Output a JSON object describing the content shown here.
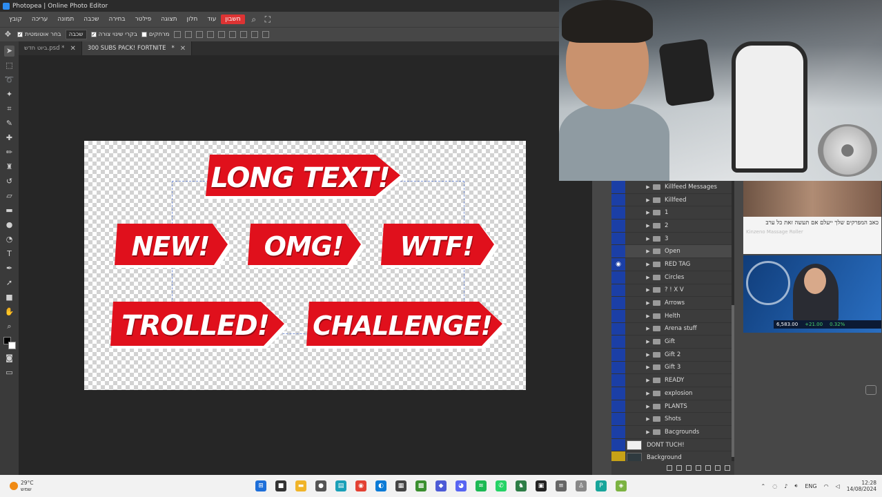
{
  "window": {
    "title": "Photopea | Online Photo Editor"
  },
  "menu": {
    "items": [
      "קובץ",
      "עריכה",
      "תמונה",
      "שכבה",
      "בחירה",
      "פילטר",
      "תצוגה",
      "חלון",
      "עוד"
    ],
    "highlight": "חשבון"
  },
  "options": {
    "auto_select_label": "בחר אוטומטית",
    "layer_select": "שכבה",
    "show_transform_label": "בקרי שינוי צורה",
    "distances_label": "מרחקים"
  },
  "tabs": [
    {
      "label": "ביוט חדש.psd *",
      "active": false
    },
    {
      "label": "300 SUBS PACK! FORTNITE",
      "active": true
    }
  ],
  "canvas": {
    "tags": [
      {
        "text": "LONG TEXT!"
      },
      {
        "text": "NEW!"
      },
      {
        "text": "OMG!"
      },
      {
        "text": "WTF!"
      },
      {
        "text": "TROLLED!"
      },
      {
        "text": "CHALLENGE!"
      }
    ],
    "tag_color": "#e0101c"
  },
  "layers": [
    {
      "name": "Killfeed Messages",
      "type": "folder"
    },
    {
      "name": "Killfeed",
      "type": "folder"
    },
    {
      "name": "1",
      "type": "folder"
    },
    {
      "name": "2",
      "type": "folder"
    },
    {
      "name": "3",
      "type": "folder"
    },
    {
      "name": "Open",
      "type": "folder"
    },
    {
      "name": "RED TAG",
      "type": "folder",
      "visible": true
    },
    {
      "name": "Circles",
      "type": "folder"
    },
    {
      "name": "? ! X V",
      "type": "folder"
    },
    {
      "name": "Arrows",
      "type": "folder"
    },
    {
      "name": "Helth",
      "type": "folder"
    },
    {
      "name": "Arena stuff",
      "type": "folder"
    },
    {
      "name": "Gift",
      "type": "folder"
    },
    {
      "name": "Gift 2",
      "type": "folder"
    },
    {
      "name": "Gift 3",
      "type": "folder"
    },
    {
      "name": "READY",
      "type": "folder"
    },
    {
      "name": "explosion",
      "type": "folder"
    },
    {
      "name": "PLANTS",
      "type": "folder"
    },
    {
      "name": "Shots",
      "type": "folder"
    },
    {
      "name": "Bacgrounds",
      "type": "folder"
    },
    {
      "name": "DONT TUCH!",
      "type": "layer"
    },
    {
      "name": "Background",
      "type": "layer"
    }
  ],
  "ads": {
    "ad1_text": "כאב המפרקים שלך ייעלם אם תעשה זאת כל ערב",
    "ad1_source": "Kinzeno Massage Roller",
    "ticker": [
      "6,583.00",
      "+21.00",
      "0.32%"
    ]
  },
  "taskbar": {
    "temp": "29°C",
    "condition": "שמש",
    "lang": "ENG",
    "time": "12:28",
    "date": "14/08/2024"
  }
}
